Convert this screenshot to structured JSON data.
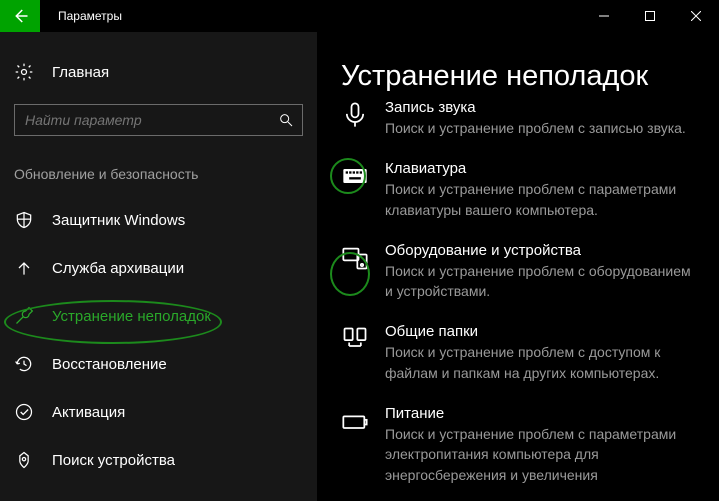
{
  "titlebar": {
    "title": "Параметры"
  },
  "sidebar": {
    "home_label": "Главная",
    "search_placeholder": "Найти параметр",
    "section_title": "Обновление и безопасность",
    "items": [
      {
        "label": "Защитник Windows"
      },
      {
        "label": "Служба архивации"
      },
      {
        "label": "Устранение неполадок"
      },
      {
        "label": "Восстановление"
      },
      {
        "label": "Активация"
      },
      {
        "label": "Поиск устройства"
      }
    ]
  },
  "content": {
    "heading": "Устранение неполадок",
    "items": [
      {
        "title": "Запись звука",
        "desc": "Поиск и устранение проблем с записью звука."
      },
      {
        "title": "Клавиатура",
        "desc": "Поиск и устранение проблем с параметрами клавиатуры вашего компьютера."
      },
      {
        "title": "Оборудование и устройства",
        "desc": "Поиск и устранение проблем с оборудованием и устройствами."
      },
      {
        "title": "Общие папки",
        "desc": "Поиск и устранение проблем с доступом к файлам и папкам на других компьютерах."
      },
      {
        "title": "Питание",
        "desc": "Поиск и устранение проблем с параметрами электропитания компьютера для энергосбережения и увеличения"
      }
    ]
  }
}
